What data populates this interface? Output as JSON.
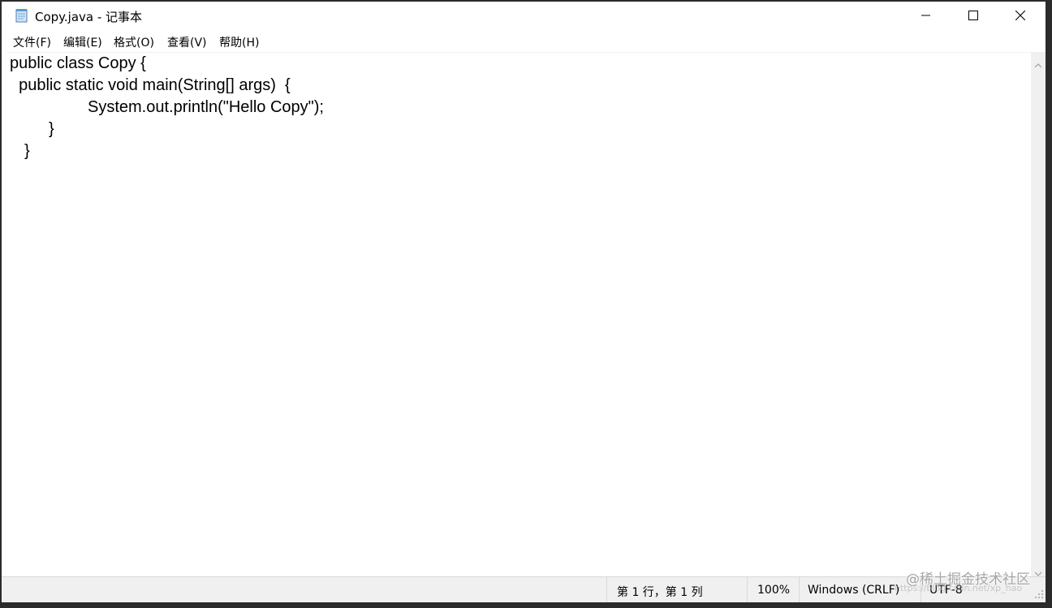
{
  "window": {
    "title": "Copy.java - 记事本"
  },
  "menu": {
    "items": [
      {
        "label": "文件(F)"
      },
      {
        "label": "编辑(E)"
      },
      {
        "label": "格式(O)"
      },
      {
        "label": "查看(V)"
      },
      {
        "label": "帮助(H)"
      }
    ]
  },
  "editor": {
    "lines": [
      "public class Copy {",
      "  public static void main(String[] args)  {",
      "System.out.println(\"Hello Copy\");",
      "}",
      "}"
    ]
  },
  "status": {
    "position": "第 1 行，第 1 列",
    "zoom": "100%",
    "line_ending": "Windows (CRLF)",
    "encoding": "UTF-8"
  },
  "watermark": {
    "text": "@稀土掘金技术社区",
    "url": "https://blog.csdn.net/xp_hao"
  },
  "icons": {
    "app": "notepad-icon",
    "minimize": "minimize-icon",
    "maximize": "maximize-icon",
    "close": "close-icon",
    "scroll_up": "chevron-up-icon",
    "scroll_down": "chevron-down-icon",
    "resize": "resize-grip-icon"
  },
  "colors": {
    "frame": "#2b2b2b",
    "background": "#ffffff",
    "statusbar": "#f0f0f0"
  }
}
